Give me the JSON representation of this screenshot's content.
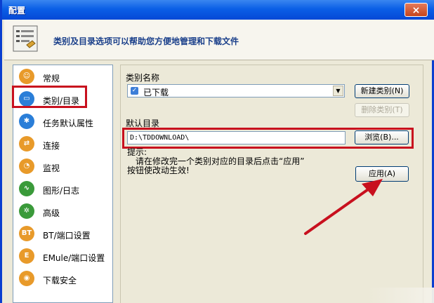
{
  "window": {
    "title": "配置",
    "close_label": "×"
  },
  "header": {
    "text": "类别及目录选项可以帮助您方便地管理和下载文件"
  },
  "sidebar": {
    "items": [
      {
        "label": "常规",
        "icon": "user-icon",
        "color": "#e89a2a"
      },
      {
        "label": "类别/目录",
        "icon": "folder-icon",
        "color": "#2a7ed8"
      },
      {
        "label": "任务默认属性",
        "icon": "asterisk-icon",
        "color": "#2a7ed8"
      },
      {
        "label": "连接",
        "icon": "connection-icon",
        "color": "#e89a2a"
      },
      {
        "label": "监视",
        "icon": "monitor-icon",
        "color": "#e89a2a"
      },
      {
        "label": "图形/日志",
        "icon": "chart-icon",
        "color": "#3a9a3a"
      },
      {
        "label": "高级",
        "icon": "gear-icon",
        "color": "#3a9a3a"
      },
      {
        "label": "BT/端口设置",
        "icon": "bt-icon",
        "color": "#e89a2a"
      },
      {
        "label": "EMule/端口设置",
        "icon": "emule-icon",
        "color": "#e89a2a"
      },
      {
        "label": "下载安全",
        "icon": "shield-icon",
        "color": "#e89a2a"
      }
    ]
  },
  "category": {
    "label": "类别名称",
    "selected": "已下载",
    "new_button": "新建类别(N)",
    "delete_button": "删除类别(T)"
  },
  "directory": {
    "label": "默认目录",
    "value": "D:\\TDDOWNLOAD\\",
    "browse_button": "浏览(B)..."
  },
  "hint": {
    "title": "提示:",
    "line1": "请在修改完一个类别对应的目录后点击“应用”",
    "line2": "按钮使改动生效!"
  },
  "apply_button": "应用(A)",
  "colors": {
    "highlight": "#c8101e",
    "titlebar": "#0b5fe6"
  }
}
